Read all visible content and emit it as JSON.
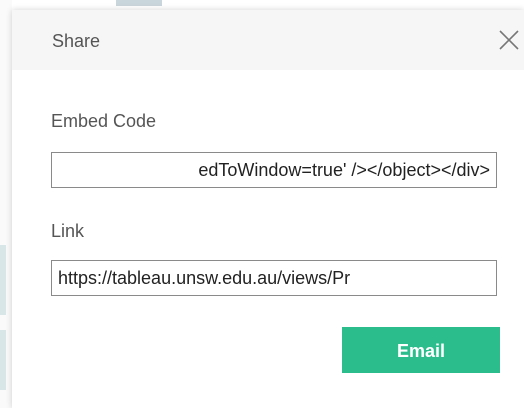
{
  "dialog": {
    "title": "Share",
    "close_icon": "close-icon"
  },
  "embed": {
    "label": "Embed Code",
    "value": "edToWindow=true' /></object></div>"
  },
  "link": {
    "label": "Link",
    "value": "https://tableau.unsw.edu.au/views/Pr"
  },
  "actions": {
    "email_label": "Email"
  },
  "colors": {
    "accent": "#2bbd8c",
    "header_bg": "#f6f6f6",
    "text": "#555555"
  }
}
